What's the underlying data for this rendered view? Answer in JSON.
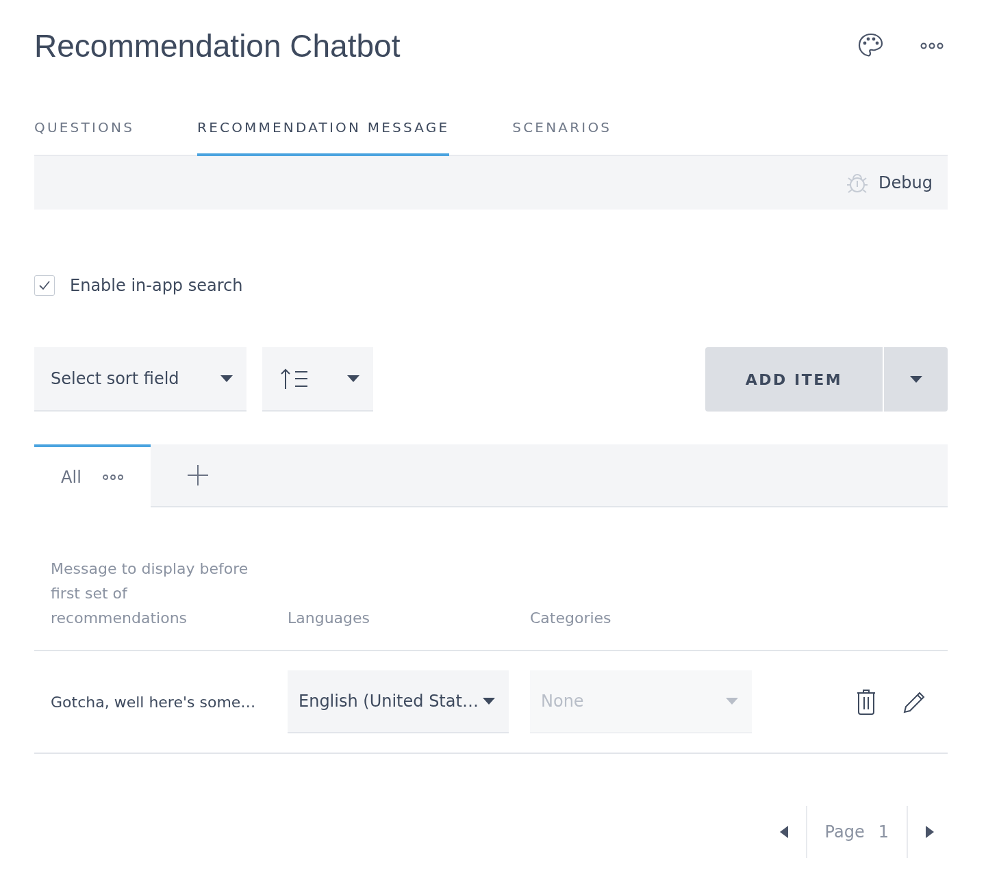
{
  "header": {
    "title": "Recommendation Chatbot"
  },
  "tabs": [
    {
      "label": "QUESTIONS",
      "selected": false
    },
    {
      "label": "RECOMMENDATION MESSAGE",
      "selected": true
    },
    {
      "label": "SCENARIOS",
      "selected": false
    }
  ],
  "toolbar": {
    "debug_label": "Debug"
  },
  "search_option": {
    "label": "Enable in-app search",
    "checked": true
  },
  "sort": {
    "placeholder": "Select sort field"
  },
  "add_item": {
    "label": "ADD ITEM"
  },
  "views": [
    {
      "label": "All",
      "selected": true
    }
  ],
  "table": {
    "columns": [
      "Message to display before first set of recommendations",
      "Languages",
      "Categories"
    ],
    "rows": [
      {
        "message": "Gotcha, well here's some…",
        "language": "English (United Stat…",
        "categories_placeholder": "None"
      }
    ]
  },
  "pagination": {
    "label": "Page",
    "page": "1"
  }
}
